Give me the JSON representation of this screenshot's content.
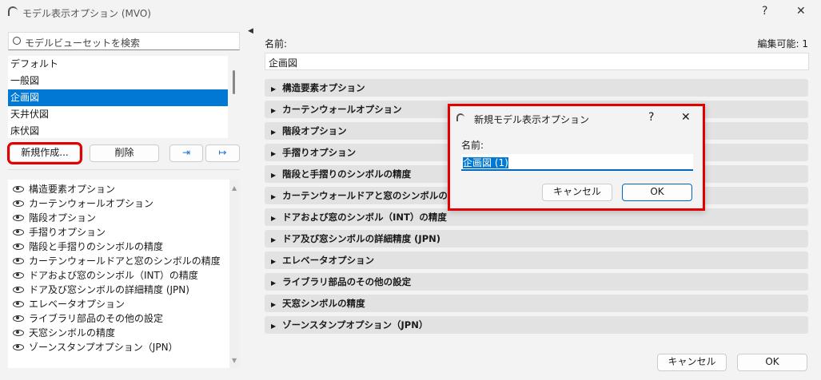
{
  "window": {
    "title": "モデル表示オプション (MVO)",
    "help": "?",
    "close": "✕"
  },
  "search": {
    "placeholder": "モデルビューセットを検索"
  },
  "sets": [
    "デフォルト",
    "一般図",
    "企画図",
    "天井伏図",
    "床伏図"
  ],
  "selected_set": 2,
  "buttons": {
    "new": "新規作成...",
    "delete": "削除",
    "ok": "OK",
    "cancel": "キャンセル"
  },
  "options": [
    "構造要素オプション",
    "カーテンウォールオプション",
    "階段オプション",
    "手摺りオプション",
    "階段と手摺りのシンボルの精度",
    "カーテンウォールドアと窓のシンボルの精度",
    "ドアおよび窓のシンボル（INT）の精度",
    "ドア及び窓シンボルの詳細精度 (JPN)",
    "エレベータオプション",
    "ライブラリ部品のその他の設定",
    "天窓シンボルの精度",
    "ゾーンスタンプオプション（JPN）"
  ],
  "right": {
    "name_label": "名前:",
    "editable": "編集可能: 1",
    "name_value": "企画図"
  },
  "dialog": {
    "title": "新規モデル表示オプション",
    "help": "?",
    "close": "✕",
    "name_label": "名前:",
    "name_value": "企画図 (1)",
    "cancel": "キャンセル",
    "ok": "OK"
  }
}
